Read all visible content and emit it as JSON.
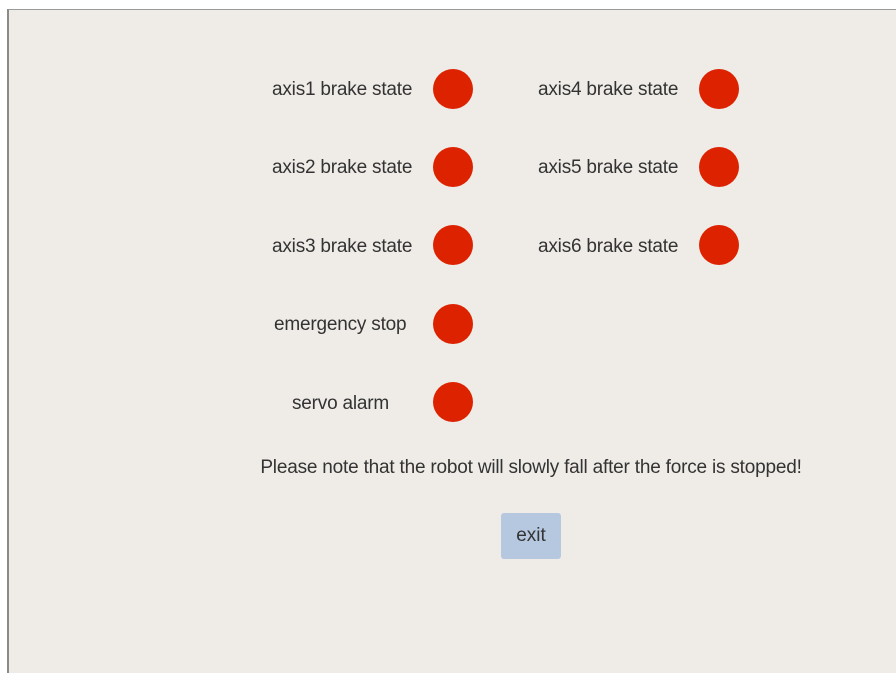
{
  "indicators": [
    {
      "label": "axis1 brake state",
      "state_color": "#dd2200"
    },
    {
      "label": "axis2 brake state",
      "state_color": "#dd2200"
    },
    {
      "label": "axis3 brake state",
      "state_color": "#dd2200"
    },
    {
      "label": "emergency stop",
      "state_color": "#dd2200"
    },
    {
      "label": "servo alarm",
      "state_color": "#dd2200"
    },
    {
      "label": "axis4 brake state",
      "state_color": "#dd2200"
    },
    {
      "label": "axis5 brake state",
      "state_color": "#dd2200"
    },
    {
      "label": "axis6 brake state",
      "state_color": "#dd2200"
    }
  ],
  "notice": "Please note that the robot will slowly fall after the force is stopped!",
  "exit_label": "exit",
  "colors": {
    "background": "#efece8",
    "indicator_off": "#dd2200",
    "button": "#b5c8e0"
  }
}
